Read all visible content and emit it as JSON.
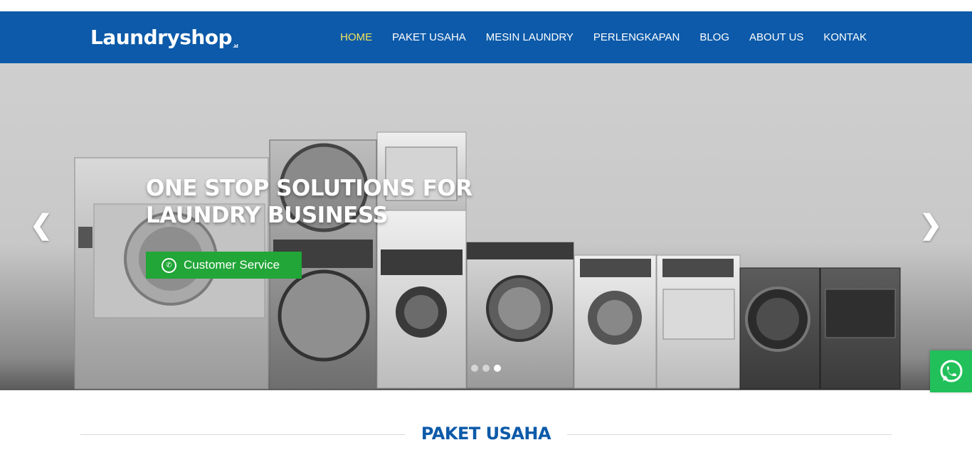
{
  "brand": {
    "logo_text": "Laundryshop",
    "logo_suffix": ".id"
  },
  "nav": {
    "items": [
      {
        "label": "HOME",
        "active": true
      },
      {
        "label": "PAKET USAHA",
        "active": false
      },
      {
        "label": "MESIN LAUNDRY",
        "active": false
      },
      {
        "label": "PERLENGKAPAN",
        "active": false
      },
      {
        "label": "BLOG",
        "active": false
      },
      {
        "label": "ABOUT US",
        "active": false
      },
      {
        "label": "KONTAK",
        "active": false
      }
    ]
  },
  "hero": {
    "title_line1": "ONE STOP SOLUTIONS FOR",
    "title_line2": "LAUNDRY BUSINESS",
    "cta_label": "Customer Service",
    "cta_icon": "whatsapp-icon",
    "prev_icon": "chevron-left-icon",
    "next_icon": "chevron-right-icon",
    "slides_total": 3,
    "active_slide": 3
  },
  "floating": {
    "icon": "whatsapp-icon"
  },
  "section": {
    "title": "PAKET USAHA"
  },
  "colors": {
    "primary": "#0c5aa9",
    "active_nav": "#f3e15b",
    "whatsapp": "#21a637"
  }
}
